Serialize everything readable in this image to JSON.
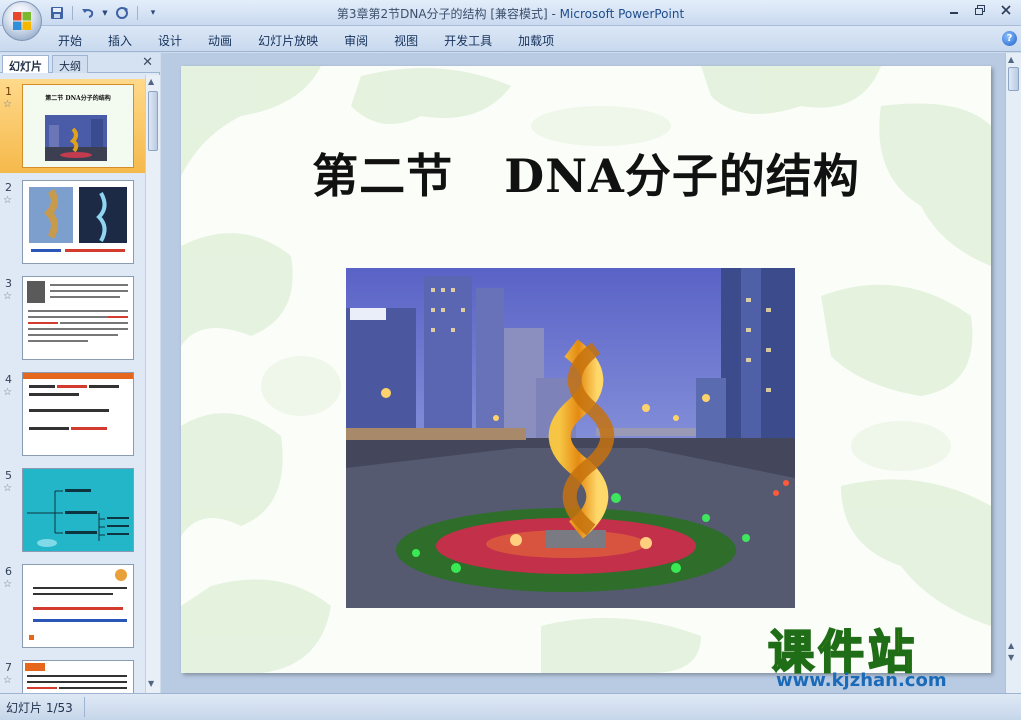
{
  "window": {
    "title": "第3章第2节DNA分子的结构 [兼容模式] - ",
    "app_name": "Microsoft PowerPoint"
  },
  "quick_access": {
    "icons": [
      "save-icon",
      "undo-icon",
      "redo-icon",
      "customize-icon"
    ]
  },
  "ribbon": {
    "tabs": [
      "开始",
      "插入",
      "设计",
      "动画",
      "幻灯片放映",
      "审阅",
      "视图",
      "开发工具",
      "加载项"
    ]
  },
  "left_pane": {
    "tab_slides": "幻灯片",
    "tab_outline": "大纲",
    "thumbnails": [
      {
        "number": "1",
        "title": "第二节  DNA分子的结构"
      },
      {
        "number": "2"
      },
      {
        "number": "3"
      },
      {
        "number": "4"
      },
      {
        "number": "5"
      },
      {
        "number": "6"
      },
      {
        "number": "7"
      }
    ],
    "selected": 1
  },
  "slide": {
    "title": "第二节   DNA分子的结构",
    "image": "city-plaza-dna-sculpture-photo"
  },
  "watermark": {
    "text": "课件站",
    "url": "www.kjzhan.com"
  },
  "status": {
    "slide_counter": "幻灯片 1/53"
  }
}
